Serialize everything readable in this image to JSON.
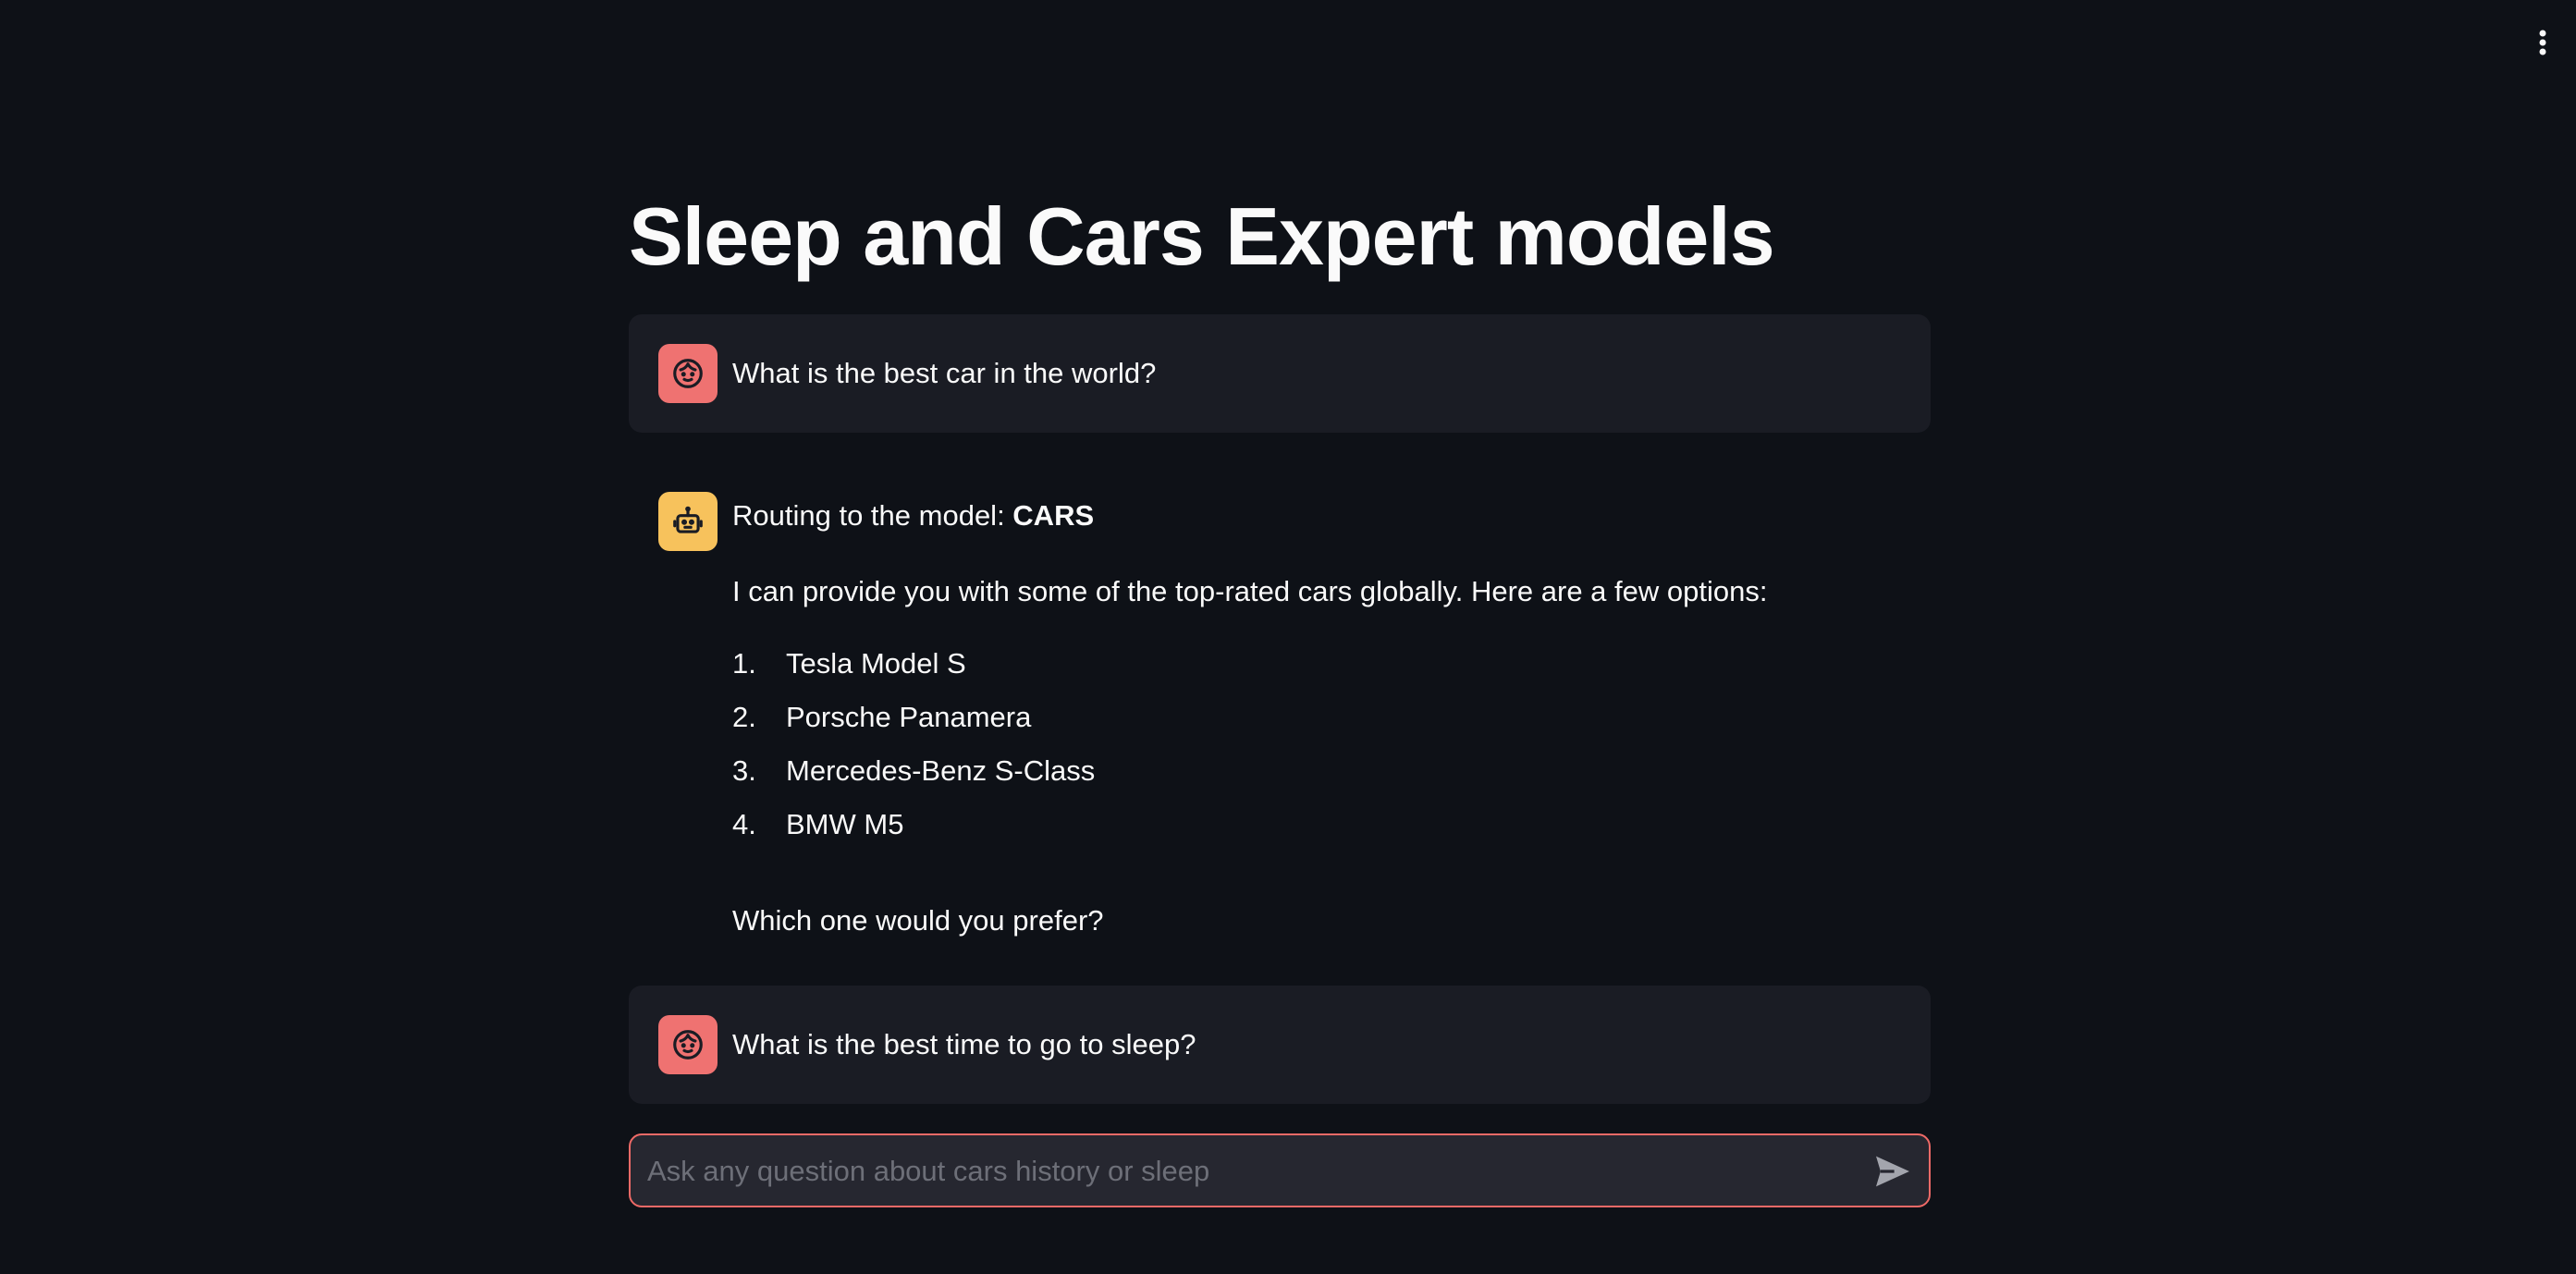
{
  "header": {
    "menu_icon": "vertical-ellipsis-icon"
  },
  "page": {
    "title": "Sleep and Cars Expert models"
  },
  "colors": {
    "background": "#0e1117",
    "user_message_background": "#1a1c24",
    "user_avatar": "#ef7271",
    "assistant_avatar": "#f7c25c",
    "input_border": "#ef6a67",
    "input_background": "#262730"
  },
  "messages": [
    {
      "role": "user",
      "avatar_icon": "user-face-icon",
      "text": "What is the best car in the world?"
    },
    {
      "role": "assistant",
      "avatar_icon": "robot-icon",
      "routing_prefix": "Routing to the model: ",
      "routing_model": "CARS",
      "intro": "I can provide you with some of the top-rated cars globally. Here are a few options:",
      "list": [
        {
          "num": "1.",
          "text": "Tesla Model S"
        },
        {
          "num": "2.",
          "text": "Porsche Panamera"
        },
        {
          "num": "3.",
          "text": "Mercedes-Benz S-Class"
        },
        {
          "num": "4.",
          "text": "BMW M5"
        }
      ],
      "outro": "Which one would you prefer?"
    },
    {
      "role": "user",
      "avatar_icon": "user-face-icon",
      "text": "What is the best time to go to sleep?"
    }
  ],
  "chat_input": {
    "placeholder": "Ask any question about cars history or sleep",
    "value": "",
    "send_icon": "send-icon"
  }
}
